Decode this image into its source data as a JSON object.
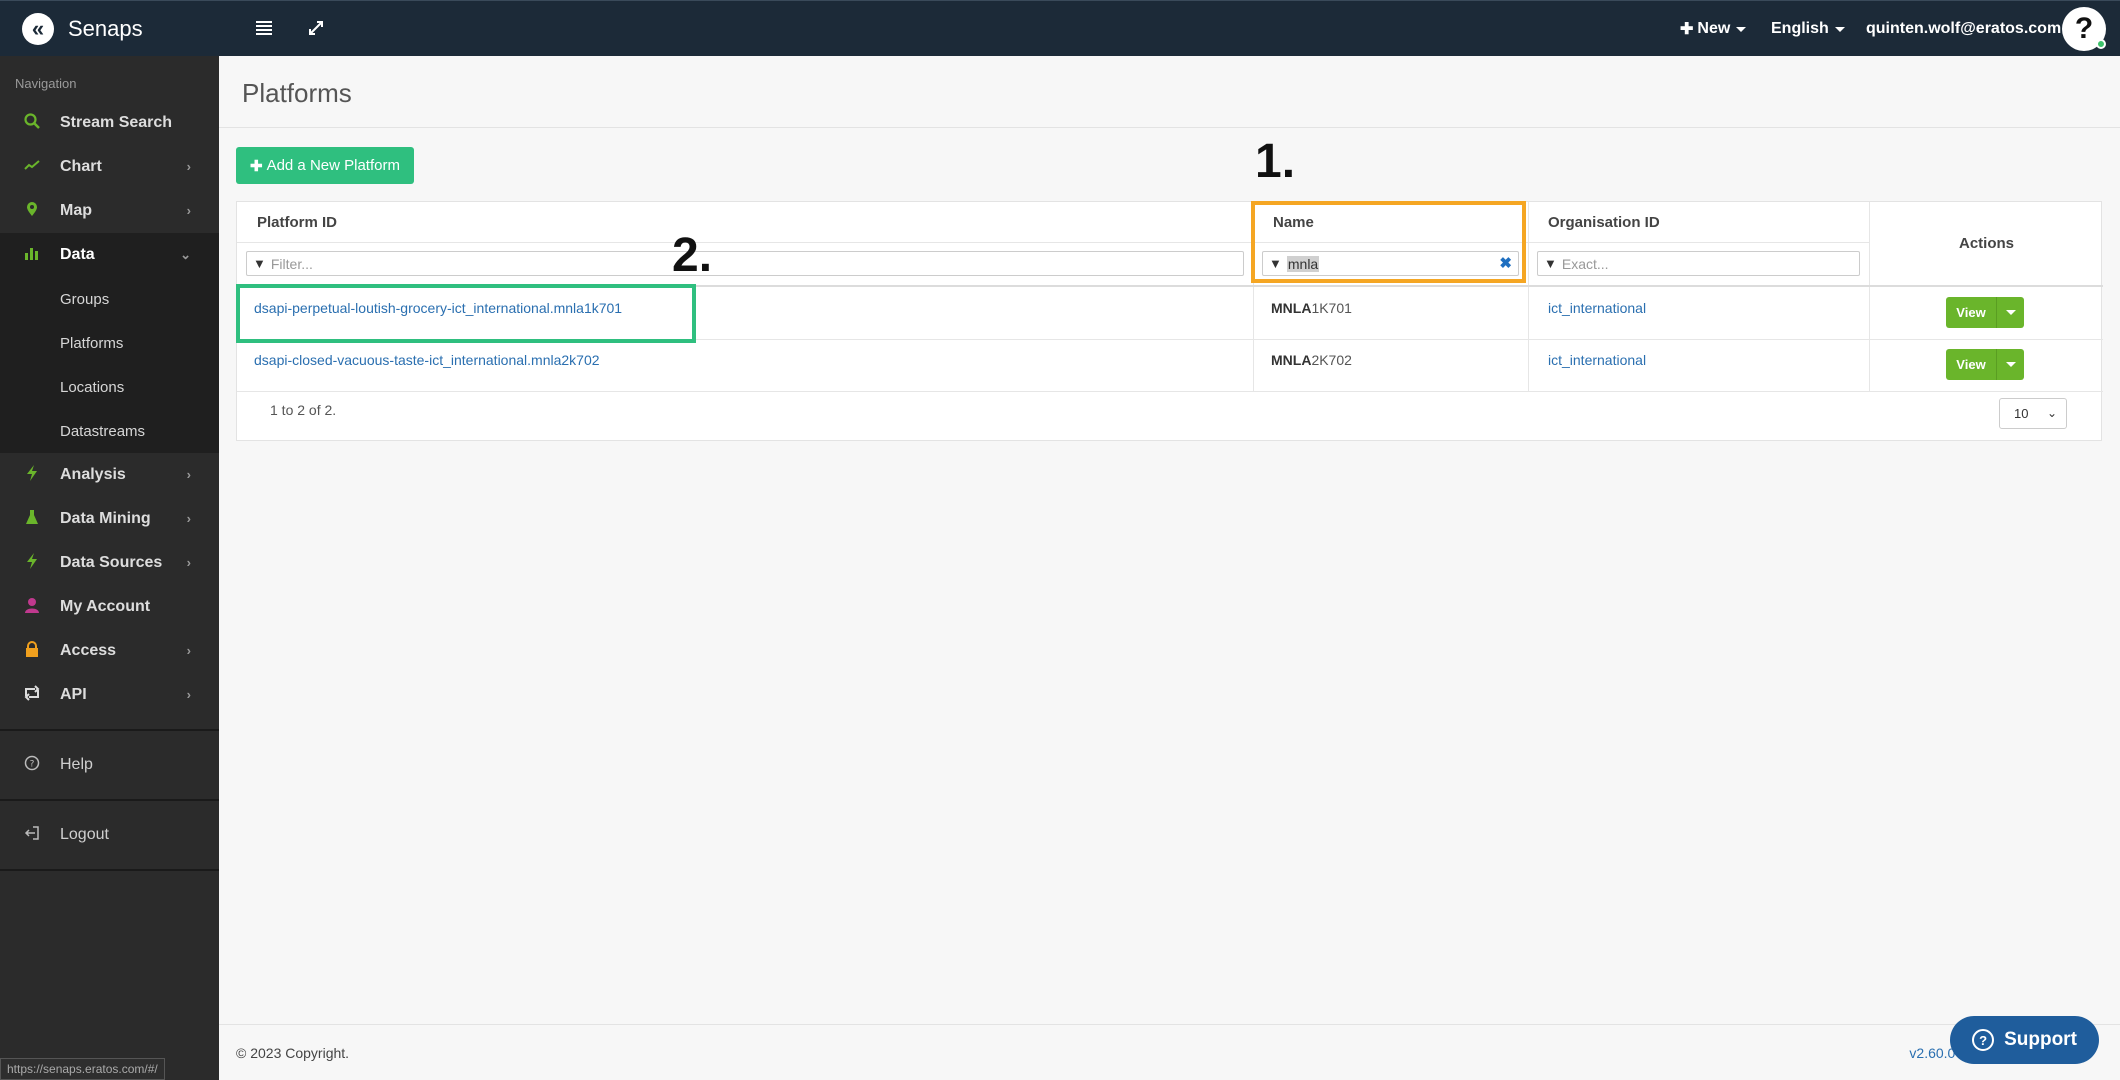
{
  "app": {
    "brand_name": "Senaps",
    "brand_logo_glyph": "«"
  },
  "topbar": {
    "new_label": "New",
    "language_label": "English",
    "user_email": "quinten.wolf@eratos.com",
    "avatar_glyph": "?"
  },
  "sidebar": {
    "heading": "Navigation",
    "items": [
      {
        "label": "Stream Search",
        "icon": "search-icon",
        "icon_glyph": "⚲",
        "icon_color": "#6ab52b"
      },
      {
        "label": "Chart",
        "icon": "line-chart-icon",
        "icon_glyph": "↗",
        "icon_color": "#6ab52b"
      },
      {
        "label": "Map",
        "icon": "map-pin-icon",
        "icon_glyph": "●",
        "icon_color": "#6ab52b"
      },
      {
        "label": "Data",
        "icon": "bar-chart-icon",
        "icon_glyph": "▐",
        "icon_color": "#6ab52b"
      },
      {
        "label": "Analysis",
        "icon": "bolt-icon",
        "icon_glyph": "ϟ",
        "icon_color": "#6ab52b"
      },
      {
        "label": "Data Mining",
        "icon": "flask-icon",
        "icon_glyph": "▲",
        "icon_color": "#6ab52b"
      },
      {
        "label": "Data Sources",
        "icon": "bolt-icon",
        "icon_glyph": "ϟ",
        "icon_color": "#6ab52b"
      },
      {
        "label": "My Account",
        "icon": "user-icon",
        "icon_glyph": "●",
        "icon_color": "#c0398e"
      },
      {
        "label": "Access",
        "icon": "lock-icon",
        "icon_glyph": "■",
        "icon_color": "#f0a01e"
      },
      {
        "label": "API",
        "icon": "retweet-icon",
        "icon_glyph": "⇄",
        "icon_color": "#dddddd"
      }
    ],
    "data_subitems": [
      "Groups",
      "Platforms",
      "Locations",
      "Datastreams"
    ],
    "help_label": "Help",
    "logout_label": "Logout",
    "status_url": "https://senaps.eratos.com/#/"
  },
  "page": {
    "title": "Platforms",
    "add_button_label": "Add a New Platform"
  },
  "table": {
    "columns": {
      "platform_id": "Platform ID",
      "name": "Name",
      "organisation_id": "Organisation ID",
      "actions": "Actions"
    },
    "filters": {
      "platform_id_placeholder": "Filter...",
      "name_value": "mnla",
      "organisation_placeholder": "Exact..."
    },
    "rows": [
      {
        "platform_id": "dsapi-perpetual-loutish-grocery-ict_international.mnla1k701",
        "name_match": "MNLA",
        "name_rest": "1K701",
        "organisation_id": "ict_international",
        "view_label": "View"
      },
      {
        "platform_id": "dsapi-closed-vacuous-taste-ict_international.mnla2k702",
        "name_match": "MNLA",
        "name_rest": "2K702",
        "organisation_id": "ict_international",
        "view_label": "View"
      }
    ],
    "count_text": "1 to 2 of 2.",
    "page_size": "10"
  },
  "annotations": {
    "one": "1.",
    "two": "2.",
    "one_color": "#f5a623",
    "two_color": "#2fbf7f"
  },
  "footer": {
    "copyright": "© 2023 Copyright.",
    "version": "v2.60.0-"
  },
  "support": {
    "label": "Support"
  },
  "colors": {
    "topbar": "#1c2a38",
    "sidebar": "#2b2b2b",
    "accent_green": "#6ab52b",
    "link_blue": "#2a6fb0"
  }
}
